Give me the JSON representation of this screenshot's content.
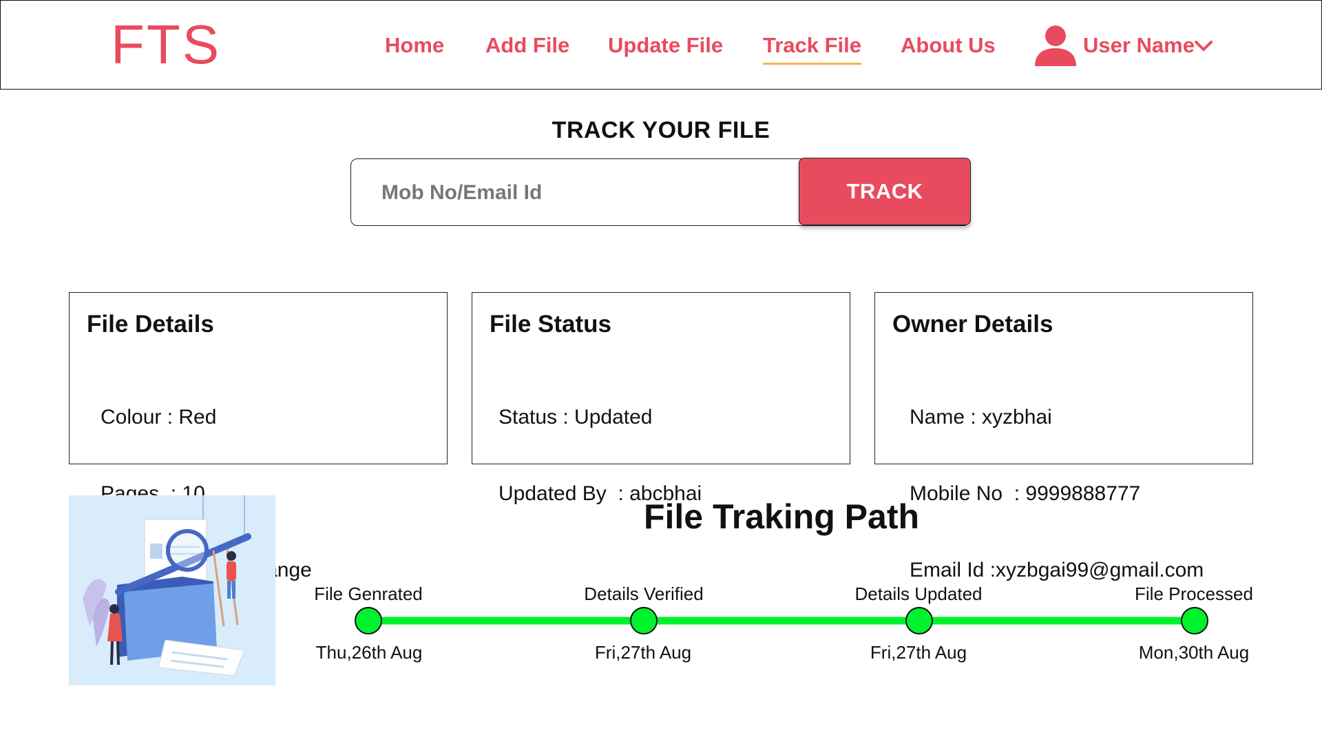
{
  "header": {
    "logo": "FTS",
    "nav": [
      {
        "label": "Home",
        "active": false
      },
      {
        "label": "Add File",
        "active": false
      },
      {
        "label": "Update File",
        "active": false
      },
      {
        "label": "Track File",
        "active": true
      },
      {
        "label": "About Us",
        "active": false
      }
    ],
    "user": {
      "name": "User Name",
      "icon": "user-icon",
      "menu_icon": "chevron-down-icon"
    }
  },
  "track": {
    "title": "TRACK YOUR FILE",
    "placeholder": "Mob No/Email Id",
    "button": "TRACK"
  },
  "cards": {
    "file_details": {
      "title": "File Details",
      "lines": [
        "Colour : Red",
        "Pages  : 10",
        "Reason : DOB Change"
      ]
    },
    "file_status": {
      "title": "File Status",
      "lines": [
        "Status : Updated",
        "Updated By  : abcbhai"
      ]
    },
    "owner_details": {
      "title": "Owner Details",
      "lines": [
        "Name : xyzbhai",
        "Mobile No  : 9999888777",
        "Email Id :xyzbgai99@gmail.com"
      ]
    }
  },
  "tracking": {
    "title": "File Traking Path",
    "steps": [
      {
        "label": "File Genrated",
        "date": "Thu,26th Aug"
      },
      {
        "label": "Details Verified",
        "date": "Fri,27th Aug"
      },
      {
        "label": "Details Updated",
        "date": "Fri,27th Aug"
      },
      {
        "label": "File Processed",
        "date": "Mon,30th Aug"
      }
    ]
  },
  "colors": {
    "brand": "#e94b5e",
    "active_underline": "#f2b64c",
    "path_green": "#00f22f",
    "illustration_bg": "#d8ecfb"
  }
}
